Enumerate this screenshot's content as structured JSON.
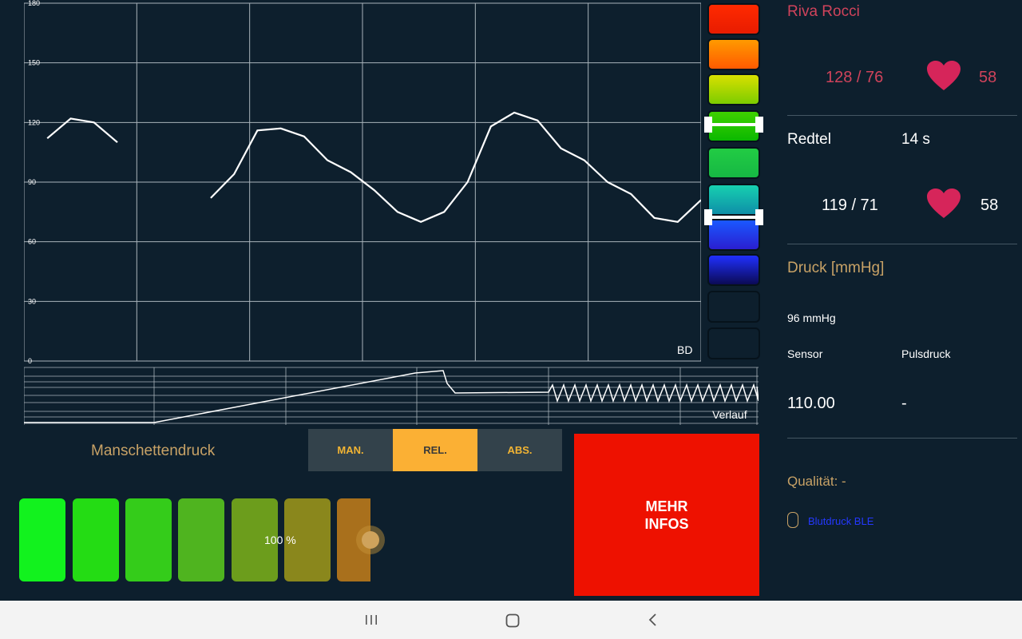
{
  "bd_chart": {
    "label": "BD",
    "y_ticks": [
      "180",
      "150",
      "120",
      "90",
      "60",
      "30",
      "0"
    ],
    "ylim": [
      0,
      180
    ],
    "segments": [
      [
        [
          1,
          112
        ],
        [
          2,
          122
        ],
        [
          3,
          120
        ],
        [
          4,
          110
        ]
      ],
      [
        [
          8,
          82
        ],
        [
          9,
          94
        ],
        [
          10,
          116
        ],
        [
          11,
          117
        ],
        [
          12,
          113
        ],
        [
          13,
          101
        ],
        [
          14,
          95
        ],
        [
          15,
          86
        ],
        [
          16,
          75
        ],
        [
          17,
          70
        ],
        [
          18,
          75
        ],
        [
          19,
          90
        ],
        [
          20,
          118
        ],
        [
          21,
          125
        ],
        [
          22,
          121
        ],
        [
          23,
          107
        ],
        [
          24,
          101
        ],
        [
          25,
          90
        ],
        [
          26,
          84
        ],
        [
          27,
          72
        ],
        [
          28,
          70
        ],
        [
          29,
          81
        ]
      ]
    ],
    "xlim": [
      0,
      29
    ]
  },
  "verlauf_chart": {
    "label": "Verlauf"
  },
  "manschetten": {
    "label": "Manschettendruck",
    "percent": "100 %",
    "level_fraction": 1.0
  },
  "modes": [
    {
      "label": "MAN.",
      "active": false
    },
    {
      "label": "REL.",
      "active": true
    },
    {
      "label": "ABS.",
      "active": false
    }
  ],
  "more_button": {
    "line1": "MEHR",
    "line2": "INFOS",
    "color": "#ee1100"
  },
  "right_panel": {
    "riva_title": "Riva Rocci",
    "riva_bp": "128 / 76",
    "riva_pulse": "58",
    "redtel_label": "Redtel",
    "redtel_time": "14 s",
    "redtel_bp": "119 / 71",
    "redtel_pulse": "58",
    "druck_title": "Druck [mmHg]",
    "druck_value": "96 mmHg",
    "sensor_label": "Sensor",
    "pulsdruck_label": "Pulsdruck",
    "sensor_value": "110.00",
    "pulsdruck_value": "-",
    "qualitaet": "Qualität: -",
    "ble_label": "Blutdruck BLE"
  },
  "colors": {
    "accent_orange": "#fbb034",
    "heart": "#d6255a",
    "riva_text": "#d0435b",
    "gold_text": "#c8a266",
    "ble_blue": "#2438ff"
  },
  "icons": [
    "heart-icon",
    "heart-icon",
    "ble-status-icon",
    "recent-apps-icon",
    "home-icon",
    "back-icon"
  ]
}
